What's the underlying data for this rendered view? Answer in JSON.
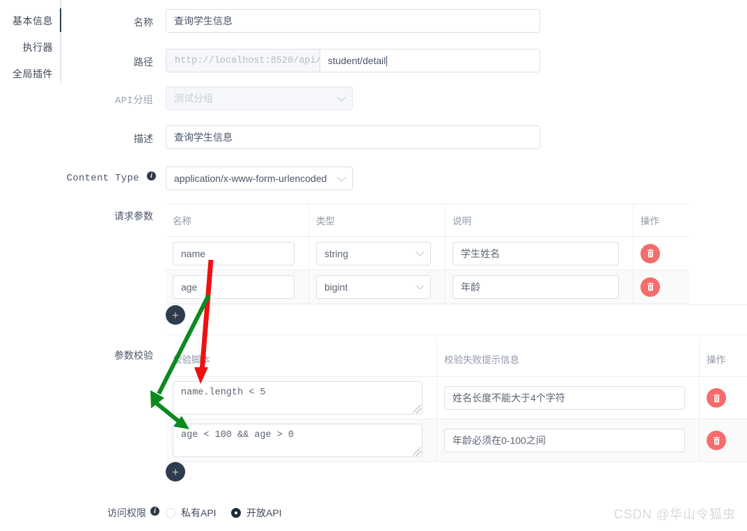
{
  "sidebar": {
    "tabs": [
      {
        "label": "基本信息",
        "active": true
      },
      {
        "label": "执行器",
        "active": false
      },
      {
        "label": "全局插件",
        "active": false
      }
    ]
  },
  "form": {
    "name": {
      "label": "名称",
      "value": "查询学生信息"
    },
    "path": {
      "label": "路径",
      "prefix": "http://localhost:8520/api/",
      "value": "student/detail"
    },
    "api_group": {
      "label": "API分组",
      "placeholder": "测试分组",
      "disabled": true
    },
    "description": {
      "label": "描述",
      "value": "查询学生信息"
    },
    "content_type": {
      "label": "Content Type",
      "value": "application/x-www-form-urlencoded",
      "info_icon": "info-icon"
    },
    "access": {
      "label": "访问权限",
      "info_icon": "info-icon",
      "options": [
        {
          "label": "私有API",
          "checked": false
        },
        {
          "label": "开放API",
          "checked": true
        }
      ]
    }
  },
  "request_params": {
    "label": "请求参数",
    "columns": [
      "名称",
      "类型",
      "说明",
      "操作"
    ],
    "rows": [
      {
        "name": "name",
        "type": "string",
        "desc": "学生姓名",
        "action": "delete-icon"
      },
      {
        "name": "age",
        "type": "bigint",
        "desc": "年龄",
        "action": "delete-icon"
      }
    ],
    "add_label": "+"
  },
  "param_validation": {
    "label": "参数校验",
    "columns": [
      "校验脚本",
      "校验失败提示信息",
      "操作"
    ],
    "rows": [
      {
        "script": "name.length < 5",
        "message": "姓名长度不能大于4个字符",
        "action": "delete-icon"
      },
      {
        "script": "age < 100 && age > 0",
        "message": "年龄必须在0-100之间",
        "action": "delete-icon"
      }
    ],
    "add_label": "+"
  },
  "watermark": {
    "text": "CSDN @华山令狐虫"
  },
  "colors": {
    "accent_dark": "#2e3c4f",
    "danger": "#f56c6c",
    "border": "#dcdfe6",
    "text": "#4a5568",
    "muted": "#9099a8",
    "arrow_red": "#ee1111",
    "arrow_green": "#0a8a1e"
  }
}
